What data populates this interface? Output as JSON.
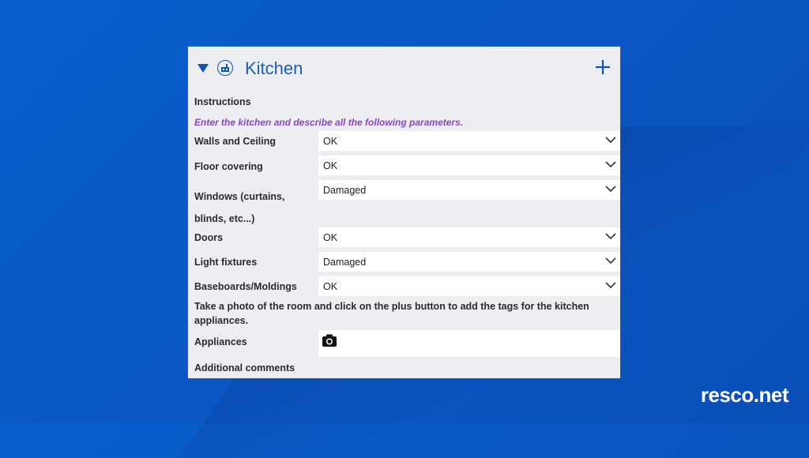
{
  "panel": {
    "title": "Kitchen",
    "instructions_label": "Instructions",
    "instructions_text": "Enter the kitchen and describe all the following parameters.",
    "fields": [
      {
        "label": "Walls and Ceiling",
        "value": "OK"
      },
      {
        "label": "Floor covering",
        "value": "OK"
      },
      {
        "label": "Windows (curtains, blinds, etc...)",
        "value": "Damaged"
      },
      {
        "label": "Doors",
        "value": "OK"
      },
      {
        "label": "Light fixtures",
        "value": "Damaged"
      },
      {
        "label": "Baseboards/Moldings",
        "value": "OK"
      }
    ],
    "photo_instruction": "Take a photo of the room and click on the plus button to add the tags for the kitchen appliances.",
    "appliances_label": "Appliances",
    "additional_comments_label": "Additional comments"
  },
  "brand": {
    "text": "resco.net"
  },
  "icons": {
    "caret": "caret-down-icon",
    "section": "house-icon",
    "add": "plus-icon",
    "dropdown": "chevron-down-icon",
    "camera": "camera-icon"
  },
  "colors": {
    "background": "#0a57c4",
    "panel": "#edeef1",
    "accent": "#1b5fb4",
    "hint": "#8a46c7"
  }
}
